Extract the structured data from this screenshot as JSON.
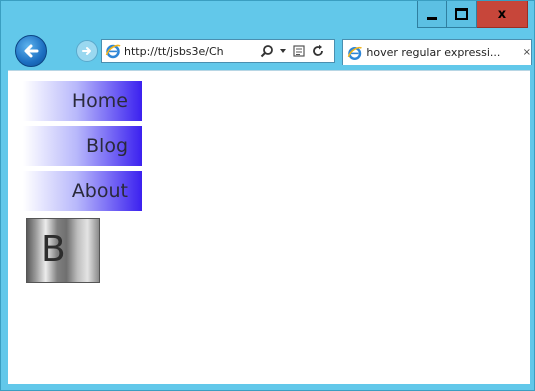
{
  "window": {
    "controls": {
      "minimize_icon": "minimize-icon",
      "maximize_icon": "maximize-icon",
      "close_label": "x"
    }
  },
  "toolbar": {
    "address_url": "http://tt/jsbs3e/Ch",
    "tab_title": "hover regular expressi...",
    "tab_close": "×",
    "icons": [
      "back-icon",
      "forward-icon",
      "ie-icon",
      "search-icon",
      "dropdown-icon",
      "compat-icon",
      "refresh-icon"
    ]
  },
  "nav": {
    "items": [
      {
        "label": "Home"
      },
      {
        "label": "Blog"
      },
      {
        "label": "About"
      }
    ]
  },
  "demo_box": {
    "letter": "B"
  },
  "colors": {
    "window_frame": "#62c8ea",
    "close_button": "#c7463a",
    "nav_gradient_end": "#3b21ef"
  }
}
